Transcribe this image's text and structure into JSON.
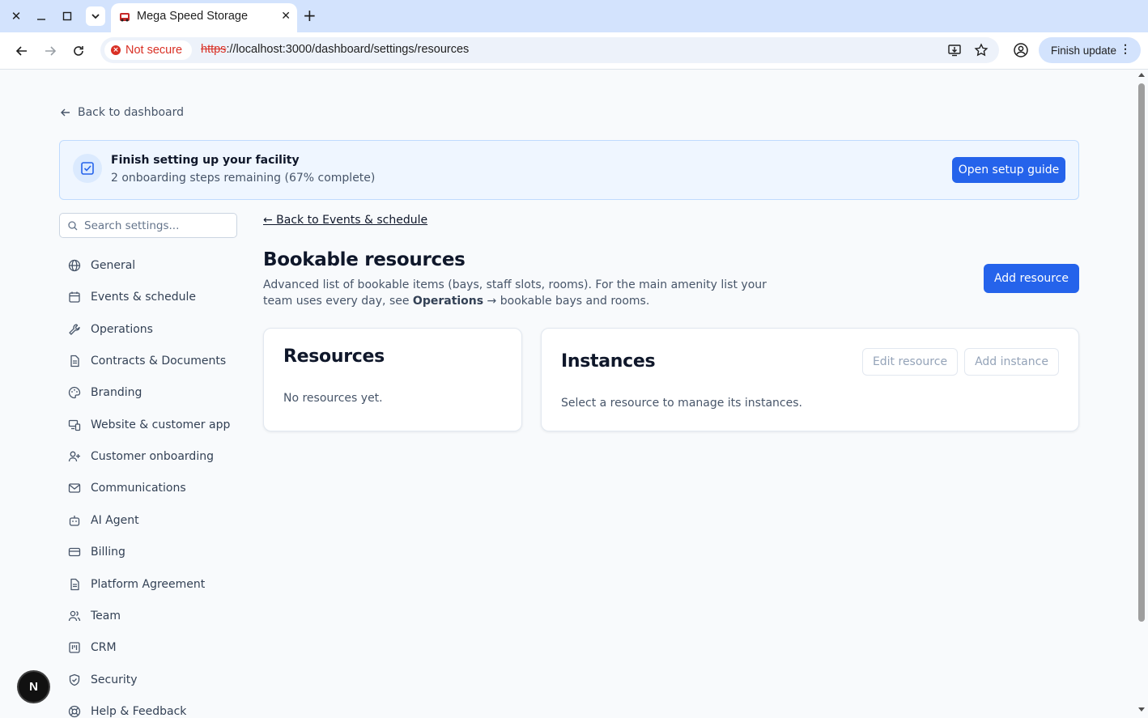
{
  "browser": {
    "tab_title": "Mega Speed Storage",
    "security_label": "Not secure",
    "url_scheme": "https",
    "url_rest": "://localhost:3000/dashboard/settings/resources",
    "finish_update_label": "Finish update"
  },
  "back_to_dashboard": "Back to dashboard",
  "banner": {
    "title": "Finish setting up your facility",
    "subtitle": "2 onboarding steps remaining (67% complete)",
    "progress_percent": 67,
    "button_label": "Open setup guide"
  },
  "search": {
    "placeholder": "Search settings..."
  },
  "sidebar": {
    "items": [
      {
        "label": "General",
        "icon": "globe-icon"
      },
      {
        "label": "Events & schedule",
        "icon": "calendar-icon"
      },
      {
        "label": "Operations",
        "icon": "wrench-icon"
      },
      {
        "label": "Contracts & Documents",
        "icon": "document-icon"
      },
      {
        "label": "Branding",
        "icon": "palette-icon"
      },
      {
        "label": "Website & customer app",
        "icon": "devices-icon"
      },
      {
        "label": "Customer onboarding",
        "icon": "user-plus-icon"
      },
      {
        "label": "Communications",
        "icon": "mail-icon"
      },
      {
        "label": "AI Agent",
        "icon": "bot-icon"
      },
      {
        "label": "Billing",
        "icon": "credit-card-icon"
      },
      {
        "label": "Platform Agreement",
        "icon": "document-icon"
      },
      {
        "label": "Team",
        "icon": "users-icon"
      },
      {
        "label": "CRM",
        "icon": "kanban-icon"
      },
      {
        "label": "Security",
        "icon": "shield-icon"
      },
      {
        "label": "Help & Feedback",
        "icon": "life-buoy-icon"
      }
    ]
  },
  "main": {
    "back_link": "← Back to Events & schedule",
    "title": "Bookable resources",
    "description_pre": "Advanced list of bookable items (bays, staff slots, rooms). For the main amenity list your team uses every day, see ",
    "description_bold": "Operations",
    "description_post": " → bookable bays and rooms.",
    "add_resource_label": "Add resource",
    "resources_card": {
      "title": "Resources",
      "empty_text": "No resources yet."
    },
    "instances_card": {
      "title": "Instances",
      "edit_resource_label": "Edit resource",
      "add_instance_label": "Add instance",
      "empty_text": "Select a resource to manage its instances."
    }
  },
  "fab_label": "N",
  "colors": {
    "accent": "#2563eb",
    "banner_bg": "#eff6ff",
    "page_bg": "#f8fafc",
    "not_secure": "#d93025"
  }
}
